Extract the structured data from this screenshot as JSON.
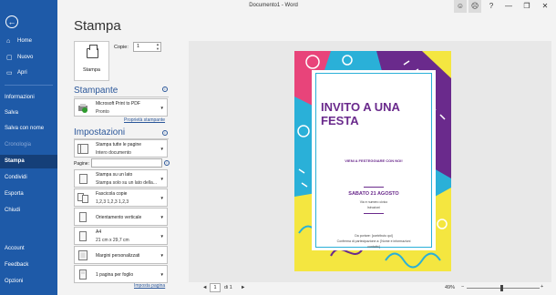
{
  "window": {
    "title": "Documento1 - Word",
    "controls": [
      "☺",
      "☹",
      "?",
      "—",
      "❐",
      "✕"
    ]
  },
  "sidebar": {
    "back_icon": "arrow-left-icon",
    "top_items": [
      {
        "label": "Home",
        "icon": "home-icon"
      },
      {
        "label": "Nuovo",
        "icon": "new-document-icon"
      },
      {
        "label": "Apri",
        "icon": "folder-icon"
      }
    ],
    "middle_items": [
      "Informazioni",
      "Salva",
      "Salva con nome",
      "Cronologia",
      "Stampa",
      "Condividi",
      "Esporta",
      "Chiudi"
    ],
    "selected": "Stampa",
    "disabled": "Cronologia",
    "bottom_items": [
      "Account",
      "Feedback",
      "Opzioni"
    ]
  },
  "main": {
    "heading": "Stampa",
    "print_button_label": "Stampa",
    "copies_label": "Copie:",
    "copies_value": "1",
    "printer": {
      "section_title": "Stampante",
      "name": "Microsoft Print to PDF",
      "status": "Pronto",
      "properties_link": "Proprietà stampante"
    },
    "settings": {
      "section_title": "Impostazioni",
      "print_what": {
        "line1": "Stampa tutte le pagine",
        "line2": "Intero documento"
      },
      "pages_label": "Pagine:",
      "pages_value": "",
      "sides": {
        "line1": "Stampa su un lato",
        "line2": "Stampa solo su un lato della..."
      },
      "collation": {
        "line1": "Fascicola copie",
        "line2": "1,2,3    1,2,3    1,2,3"
      },
      "orientation": "Orientamento verticale",
      "paper": {
        "line1": "A4",
        "line2": "21 cm x 29,7 cm"
      },
      "margins": "Margini personalizzati",
      "per_sheet": "1 pagina per foglio",
      "page_setup_link": "Imposta pagina"
    }
  },
  "preview": {
    "invite": {
      "title": "INVITO A UNA FESTA",
      "subtitle": "VIENI A FESTEGGIARE CON NOI!",
      "date": "SABATO 21 AGOSTO",
      "address1": "Via e numero civico",
      "address2": "Istruzioni",
      "footer1": "Da portare: [contributo qui]",
      "footer2": "Conferma di partecipazione a: [Nome e informazioni",
      "footer3": "contatto]"
    },
    "colors": {
      "cyan": "#2ab0d8",
      "purple": "#6a2a8c",
      "yellow": "#f4e640",
      "pink": "#e8447a"
    }
  },
  "pagination": {
    "prev": "◄",
    "current": "1",
    "of_label": "di 1",
    "next": "►",
    "zoom_label": "49%",
    "zoom_minus": "−",
    "zoom_plus": "+"
  }
}
